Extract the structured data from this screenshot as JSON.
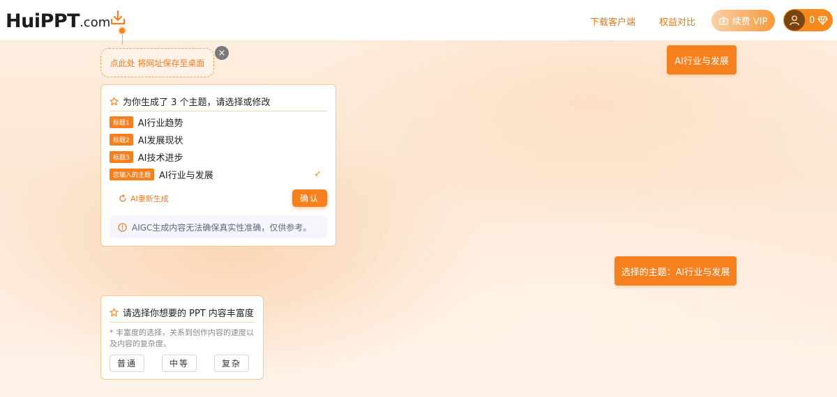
{
  "header": {
    "logo_main": "HuiPPT",
    "logo_sub": ".com",
    "download_client": "下载客户端",
    "compare_rights": "权益对比",
    "vip_label": "续费 VIP",
    "user_count": "0"
  },
  "save_tip": {
    "text": "点此处 将网址保存至桌面",
    "close": "×"
  },
  "user_messages": {
    "first": "AI行业与发展",
    "second": "选择的主题：AI行业与发展"
  },
  "topic_card": {
    "title": "为你生成了 3 个主题，请选择或修改",
    "topics": [
      {
        "tag": "标题1",
        "text": "AI行业趋势"
      },
      {
        "tag": "标题2",
        "text": "AI发展现状"
      },
      {
        "tag": "标题3",
        "text": "AI技术进步"
      },
      {
        "tag": "您输入的主题",
        "text": "AI行业与发展",
        "check": "✓"
      }
    ],
    "regenerate": "AI重新生成",
    "confirm": "确认",
    "notice": "AIGC生成内容无法确保真实性准确，仅供参考。"
  },
  "richness_card": {
    "title": "请选择你想要的 PPT 内容丰富度",
    "desc": "* 丰富度的选择，关系到创作内容的速度以及内容的复杂度。",
    "options": [
      "普通",
      "中等",
      "复杂"
    ]
  },
  "colors": {
    "accent": "#f7801e",
    "card_border": "#f8c595"
  }
}
